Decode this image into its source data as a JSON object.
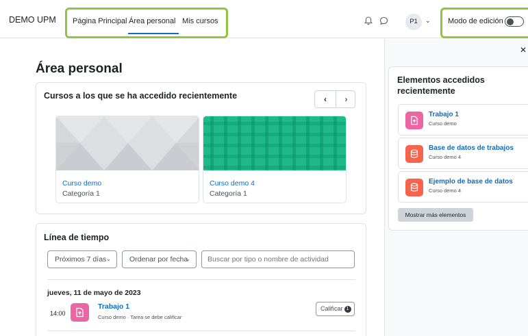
{
  "header": {
    "brand": "DEMO UPM",
    "nav": [
      {
        "label": "Página Principal"
      },
      {
        "label": "Área personal"
      },
      {
        "label": "Mis cursos"
      }
    ],
    "user_initials": "P1",
    "edit_mode_label": "Modo de edición",
    "edit_mode_on": false,
    "highlight_color": "#8dc63f"
  },
  "main": {
    "title": "Área personal",
    "recent_courses": {
      "title": "Cursos a los que se ha accedido recientemente",
      "courses": [
        {
          "name": "Curso demo",
          "category": "Categoría 1",
          "image": "grey-triangle-pattern"
        },
        {
          "name": "Curso demo 4",
          "category": "Categoría 1",
          "image": "green-plaid-pattern"
        }
      ]
    },
    "timeline": {
      "title": "Línea de tiempo",
      "filter_label": "Próximos 7 días",
      "sort_label": "Ordenar por fecha",
      "search_placeholder": "Buscar por tipo o nombre de actividad",
      "date_heading": "jueves, 11 de mayo de 2023",
      "events": [
        {
          "time": "14:00",
          "title": "Trabajo 1",
          "subtitle": "Curso demo · Tarea se debe calificar",
          "action_label": "Calificar",
          "action_count": "1",
          "icon": "assignment-icon"
        }
      ]
    }
  },
  "drawer": {
    "title": "Elementos accedidos recientemente",
    "items": [
      {
        "name": "Trabajo 1",
        "course": "Curso demo",
        "icon": "assignment-icon",
        "color": "#eb66a2"
      },
      {
        "name": "Base de datos de trabajos",
        "course": "Curso demo 4",
        "icon": "database-icon",
        "color": "#f7634d"
      },
      {
        "name": "Ejemplo de base de datos",
        "course": "Curso demo 4",
        "icon": "database-icon",
        "color": "#f7634d"
      }
    ],
    "show_more_label": "Mostrar más elementos"
  },
  "colors": {
    "link": "#0f6cbf",
    "assignment": "#eb66a2",
    "database": "#f7634d"
  }
}
